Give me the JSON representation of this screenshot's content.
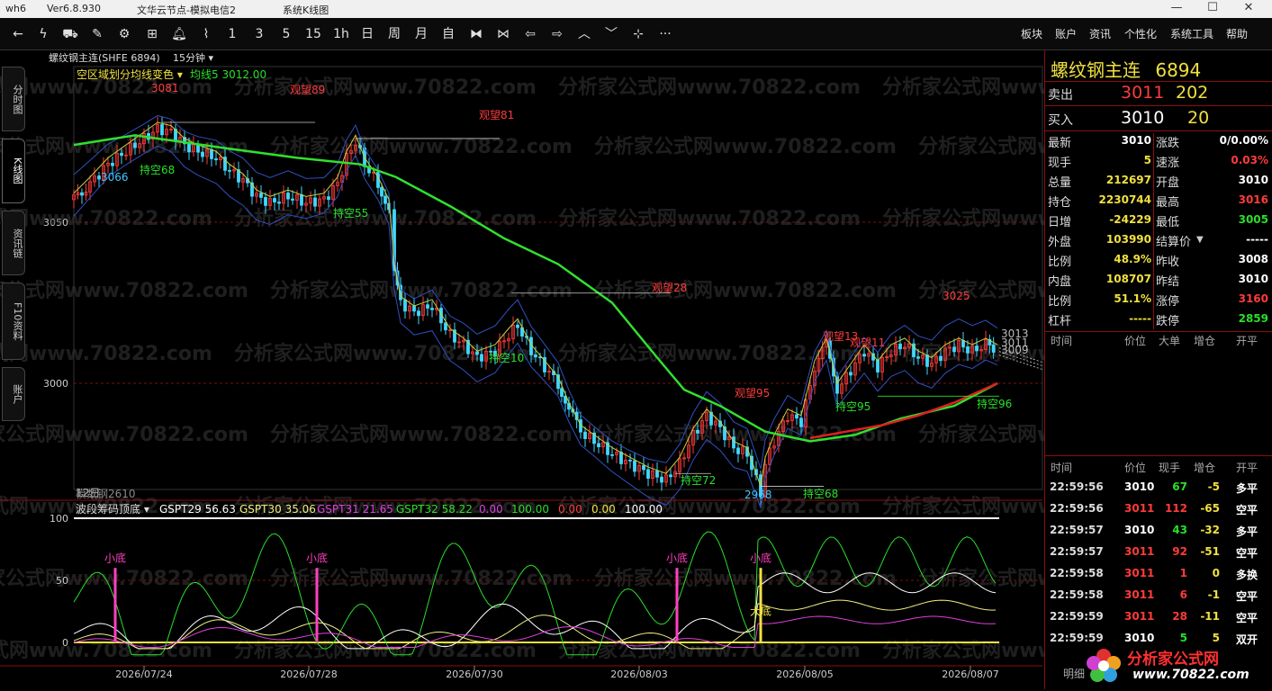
{
  "titlebar": {
    "app": "wh6",
    "version": "Ver6.8.930",
    "node": "文华云节点-模拟电信2",
    "scheme": "系统K线图",
    "minimize": "—",
    "maximize": "☐",
    "close": "✕"
  },
  "toolbar": {
    "periods": [
      "1",
      "3",
      "5",
      "15",
      "1h",
      "日",
      "周",
      "月",
      "自"
    ],
    "menus": [
      "板块",
      "账户",
      "资讯",
      "个性化",
      "系统工具",
      "帮助"
    ],
    "more": "···"
  },
  "left_tabs": [
    "分时图",
    "K线图",
    "资讯链",
    "F10资料",
    "账户"
  ],
  "chart_header": {
    "contract": "螺纹钢主连(SHFE 6894)",
    "period": "15分钟",
    "indicator": "空区域划分均线变色",
    "ma_label": "均线5 3012.00"
  },
  "price_axis": [
    "3050",
    "3000"
  ],
  "annotations": [
    {
      "text": "3081",
      "color": "#ff3b3b"
    },
    {
      "text": "3066",
      "color": "#40c8ff"
    },
    {
      "text": "观望89",
      "color": "#ff3b3b"
    },
    {
      "text": "持空68",
      "color": "#28e028"
    },
    {
      "text": "观望81",
      "color": "#ff3b3b"
    },
    {
      "text": "持空55",
      "color": "#28e028"
    },
    {
      "text": "观望28",
      "color": "#ff3b3b"
    },
    {
      "text": "持空10",
      "color": "#28e028"
    },
    {
      "text": "观望95",
      "color": "#ff3b3b"
    },
    {
      "text": "持空72",
      "color": "#28e028"
    },
    {
      "text": "2968",
      "color": "#40c8ff"
    },
    {
      "text": "持空68",
      "color": "#28e028"
    },
    {
      "text": "观望13",
      "color": "#ff3b3b"
    },
    {
      "text": "观望11",
      "color": "#ff3b3b"
    },
    {
      "text": "持空95",
      "color": "#28e028"
    },
    {
      "text": "持空96",
      "color": "#28e028"
    },
    {
      "text": "3025",
      "color": "#ff3b3b"
    },
    {
      "text": "3013",
      "color": "#bbbbbb"
    },
    {
      "text": "3011",
      "color": "#bbbbbb"
    },
    {
      "text": "3009",
      "color": "#bbbbbb"
    },
    {
      "text": "12日",
      "color": "#bbbbbb"
    },
    {
      "text": "模数钢2610",
      "color": "#888888"
    }
  ],
  "sub_chart": {
    "name": "波段筹码顶底",
    "legend": [
      {
        "text": "GSPT29 56.63",
        "color": "#ffffff"
      },
      {
        "text": "GSPT30 35.06",
        "color": "#f0f080"
      },
      {
        "text": "GSPT31 21.65",
        "color": "#e040e0"
      },
      {
        "text": "GSPT32 58.22",
        "color": "#28e028"
      },
      {
        "text": "0.00",
        "color": "#e040e0"
      },
      {
        "text": "100.00",
        "color": "#28e028"
      },
      {
        "text": "0.00",
        "color": "#ff3b3b"
      },
      {
        "text": "0.00",
        "color": "#f0e040"
      },
      {
        "text": "100.00",
        "color": "#ffffff"
      }
    ],
    "axis": [
      "100",
      "50",
      "0"
    ],
    "signals": [
      {
        "text": "小底",
        "color": "#ff40c0"
      },
      {
        "text": "小底",
        "color": "#ff40c0"
      },
      {
        "text": "小底",
        "color": "#ff40c0"
      },
      {
        "text": "小底",
        "color": "#ff40c0"
      },
      {
        "text": "大底",
        "color": "#f0e040"
      }
    ]
  },
  "date_axis": [
    "2026/07/24",
    "2026/07/28",
    "2026/07/30",
    "2026/08/03",
    "2026/08/05",
    "2026/08/07"
  ],
  "watermark": "分析家公式网www.70822.com",
  "quote": {
    "name": "螺纹钢主连",
    "code": "6894",
    "sell_label": "卖出",
    "sell_price": "3011",
    "sell_vol": "202",
    "buy_label": "买入",
    "buy_price": "3010",
    "buy_vol": "20",
    "left": [
      {
        "label": "最新",
        "value": "3010",
        "color": "#ffffff"
      },
      {
        "label": "现手",
        "value": "5",
        "color": "#f0e040"
      },
      {
        "label": "总量",
        "value": "212697",
        "color": "#f0e040"
      },
      {
        "label": "持仓",
        "value": "2230744",
        "color": "#f0e040"
      },
      {
        "label": "日增",
        "value": "-24229",
        "color": "#f0e040"
      },
      {
        "label": "外盘",
        "value": "103990",
        "color": "#f0e040"
      },
      {
        "label": "比例",
        "value": "48.9%",
        "color": "#f0e040"
      },
      {
        "label": "内盘",
        "value": "108707",
        "color": "#f0e040"
      },
      {
        "label": "比例",
        "value": "51.1%",
        "color": "#f0e040"
      },
      {
        "label": "杠杆",
        "value": "-----",
        "color": "#f0e040"
      }
    ],
    "right": [
      {
        "label": "涨跌",
        "value": "0/0.00%",
        "color": "#ffffff"
      },
      {
        "label": "速涨",
        "value": "0.03%",
        "color": "#ff3b3b"
      },
      {
        "label": "开盘",
        "value": "3010",
        "color": "#ffffff"
      },
      {
        "label": "最高",
        "value": "3016",
        "color": "#ff3b3b"
      },
      {
        "label": "最低",
        "value": "3005",
        "color": "#28e028"
      },
      {
        "label": "结算价",
        "value": "-----",
        "color": "#ffffff"
      },
      {
        "label": "昨收",
        "value": "3008",
        "color": "#ffffff"
      },
      {
        "label": "昨结",
        "value": "3010",
        "color": "#ffffff"
      },
      {
        "label": "涨停",
        "value": "3160",
        "color": "#ff3b3b"
      },
      {
        "label": "跌停",
        "value": "2859",
        "color": "#28e028"
      }
    ]
  },
  "big_order": {
    "headers": [
      "时间",
      "价位",
      "大单",
      "增仓",
      "开平"
    ]
  },
  "ticks": {
    "headers": [
      "时间",
      "价位",
      "现手",
      "增仓",
      "开平"
    ],
    "rows": [
      {
        "time": "22:59:56",
        "price": "3010",
        "pc": "#ffffff",
        "vol": "67",
        "vc": "#28e028",
        "oi": "-5",
        "type": "多平",
        "tc": "#ffffff"
      },
      {
        "time": "22:59:56",
        "price": "3011",
        "pc": "#ff3b3b",
        "vol": "112",
        "vc": "#ff3b3b",
        "oi": "-65",
        "type": "空平",
        "tc": "#ffffff"
      },
      {
        "time": "22:59:57",
        "price": "3010",
        "pc": "#ffffff",
        "vol": "43",
        "vc": "#28e028",
        "oi": "-32",
        "type": "多平",
        "tc": "#ffffff"
      },
      {
        "time": "22:59:57",
        "price": "3011",
        "pc": "#ff3b3b",
        "vol": "92",
        "vc": "#ff3b3b",
        "oi": "-51",
        "type": "空平",
        "tc": "#ffffff"
      },
      {
        "time": "22:59:58",
        "price": "3011",
        "pc": "#ff3b3b",
        "vol": "1",
        "vc": "#ff3b3b",
        "oi": "0",
        "type": "多换",
        "tc": "#ffffff"
      },
      {
        "time": "22:59:58",
        "price": "3011",
        "pc": "#ff3b3b",
        "vol": "6",
        "vc": "#ff3b3b",
        "oi": "-1",
        "type": "空平",
        "tc": "#ffffff"
      },
      {
        "time": "22:59:59",
        "price": "3011",
        "pc": "#ff3b3b",
        "vol": "28",
        "vc": "#ff3b3b",
        "oi": "-11",
        "type": "空平",
        "tc": "#ffffff"
      },
      {
        "time": "22:59:59",
        "price": "3010",
        "pc": "#ffffff",
        "vol": "5",
        "vc": "#28e028",
        "oi": "5",
        "type": "双开",
        "tc": "#ffffff"
      }
    ]
  },
  "bottom_tab": "明细",
  "logo": {
    "name": "分析家公式网",
    "url": "www.70822.com"
  }
}
